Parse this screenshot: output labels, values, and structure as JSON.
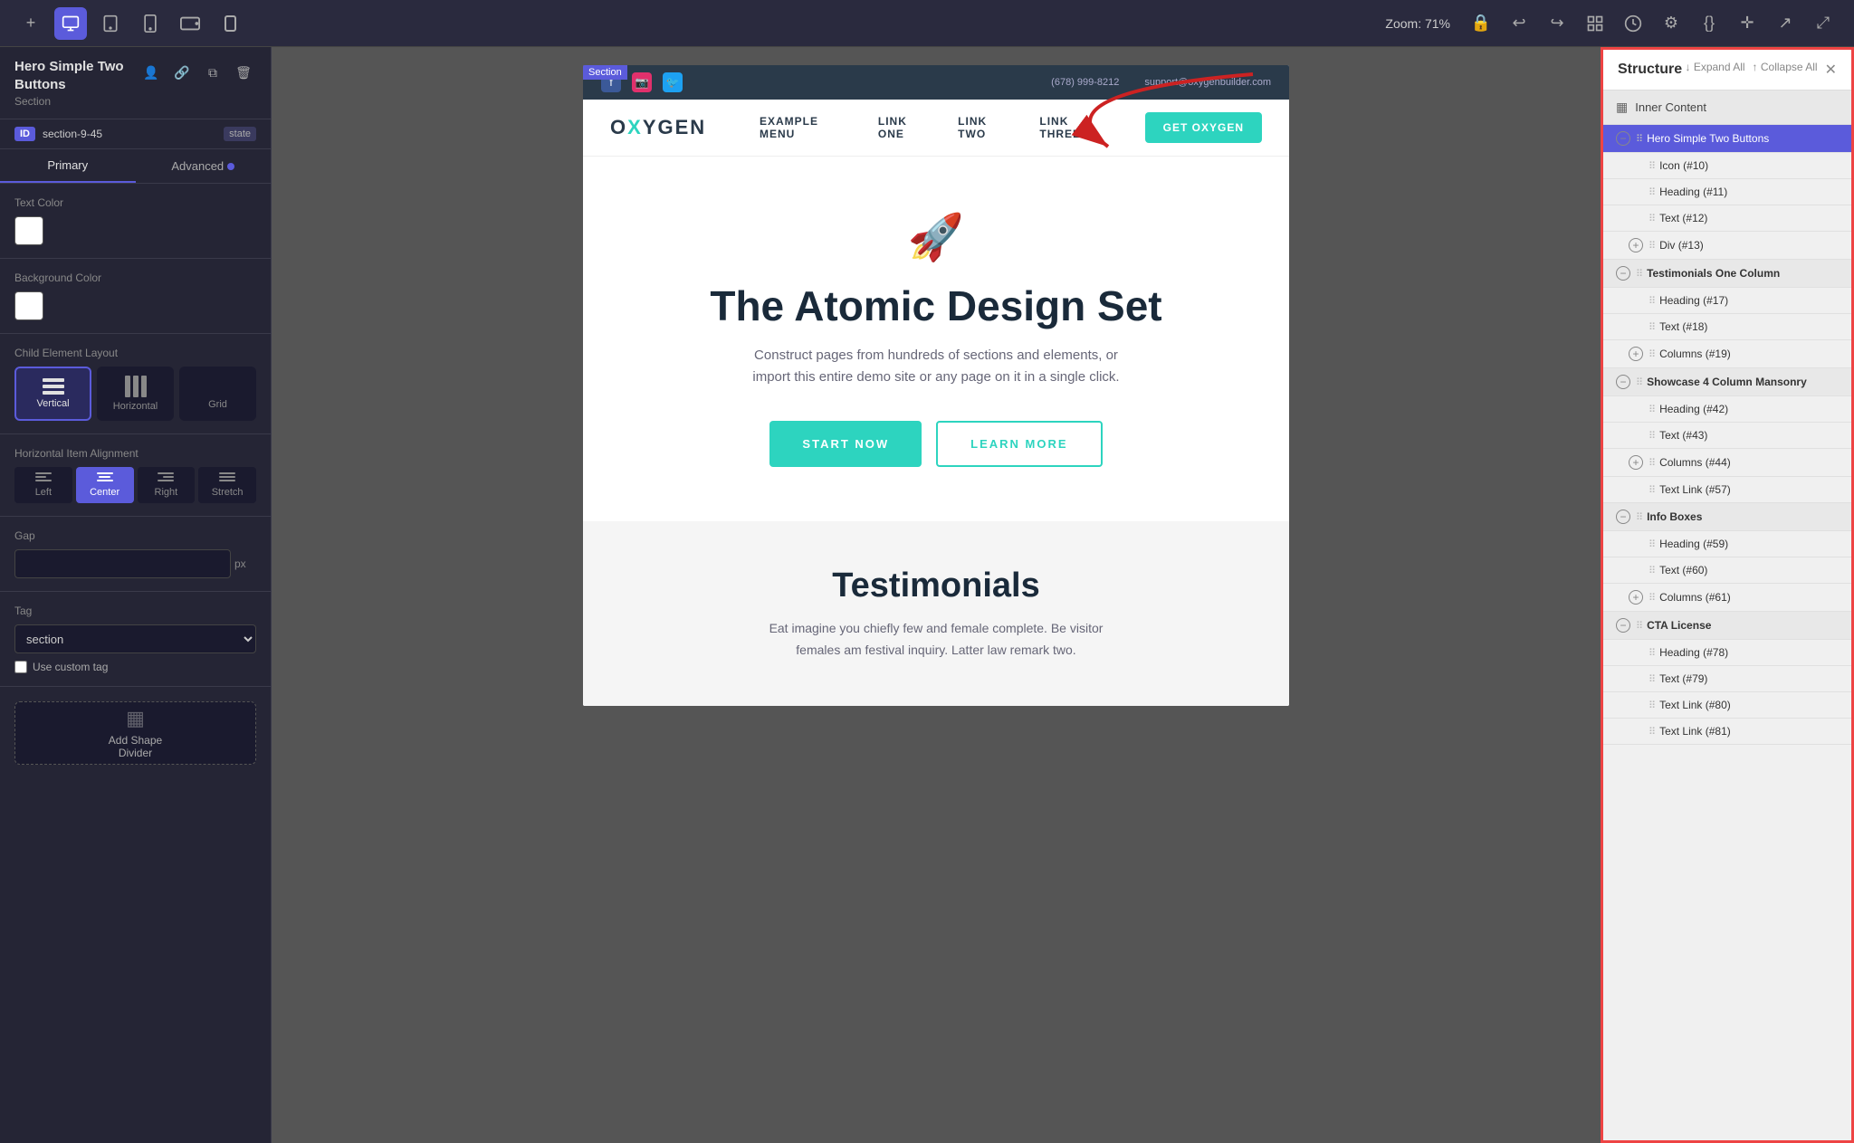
{
  "toolbar": {
    "device_desktop_label": "Desktop",
    "device_tablet_label": "Tablet",
    "device_mobile_label": "Mobile",
    "device_landscape_label": "Landscape",
    "device_mobile2_label": "Mobile 2",
    "zoom_label": "Zoom: 71%",
    "add_btn_label": "+",
    "undo_label": "↩",
    "redo_label": "↪",
    "manage_label": "☰",
    "history_label": "⏰",
    "settings_label": "⚙",
    "css_label": "{}",
    "grid_label": "+",
    "share_label": "↗",
    "expand_label": "⤢"
  },
  "left_panel": {
    "title": "Hero Simple Two Buttons",
    "subtitle": "Section",
    "id_value": "section-9-45",
    "state_label": "state",
    "tab_primary": "Primary",
    "tab_advanced": "Advanced",
    "text_color_label": "Text Color",
    "bg_color_label": "Background Color",
    "child_layout_label": "Child Element Layout",
    "layout_vertical": "Vertical",
    "layout_horizontal": "Horizontal",
    "layout_grid": "Grid",
    "alignment_label": "Horizontal Item Alignment",
    "align_left": "Left",
    "align_center": "Center",
    "align_right": "Right",
    "align_stretch": "Stretch",
    "gap_label": "Gap",
    "gap_unit": "px",
    "tag_label": "Tag",
    "tag_value": "section",
    "custom_tag_label": "Use custom tag",
    "add_shape_label": "Add Shape\nDivider"
  },
  "canvas": {
    "section_badge": "Section",
    "site_logo": "OXYGEN",
    "nav_links": [
      "EXAMPLE MENU",
      "LINK ONE",
      "LINK TWO",
      "LINK THREE"
    ],
    "nav_cta": "GET OXYGEN",
    "phone": "(678) 999-8212",
    "email": "support@oxygenbuilder.com",
    "hero_title": "The Atomic Design Set",
    "hero_subtitle": "Construct pages from hundreds of sections and elements, or import this entire demo site or any page on it in a single click.",
    "btn_start": "START NOW",
    "btn_learn": "LEARN MORE",
    "testimonials_title": "Testimonials",
    "testimonials_text": "Eat imagine you chiefly few and female complete. Be visitor females am festival inquiry. Latter law remark two."
  },
  "right_panel": {
    "title": "Structure",
    "expand_all": "↓ Expand All",
    "collapse_all": "↑ Collapse All",
    "inner_content": "Inner Content",
    "items": [
      {
        "level": 0,
        "toggle": "minus",
        "label": "Hero Simple Two Buttons",
        "active": true,
        "id": ""
      },
      {
        "level": 1,
        "toggle": "none",
        "label": "Icon (#10)",
        "active": false,
        "id": ""
      },
      {
        "level": 1,
        "toggle": "none",
        "label": "Heading (#11)",
        "active": false,
        "id": ""
      },
      {
        "level": 1,
        "toggle": "none",
        "label": "Text (#12)",
        "active": false,
        "id": ""
      },
      {
        "level": 1,
        "toggle": "plus",
        "label": "Div (#13)",
        "active": false,
        "id": ""
      },
      {
        "level": 0,
        "toggle": "minus",
        "label": "Testimonials One Column",
        "active": false,
        "id": "",
        "section": true
      },
      {
        "level": 1,
        "toggle": "none",
        "label": "Heading (#17)",
        "active": false,
        "id": ""
      },
      {
        "level": 1,
        "toggle": "none",
        "label": "Text (#18)",
        "active": false,
        "id": ""
      },
      {
        "level": 1,
        "toggle": "plus",
        "label": "Columns (#19)",
        "active": false,
        "id": ""
      },
      {
        "level": 0,
        "toggle": "minus",
        "label": "Showcase 4 Column Mansonry",
        "active": false,
        "id": "",
        "section": true
      },
      {
        "level": 1,
        "toggle": "none",
        "label": "Heading (#42)",
        "active": false,
        "id": ""
      },
      {
        "level": 1,
        "toggle": "none",
        "label": "Text (#43)",
        "active": false,
        "id": ""
      },
      {
        "level": 1,
        "toggle": "plus",
        "label": "Columns (#44)",
        "active": false,
        "id": ""
      },
      {
        "level": 1,
        "toggle": "none",
        "label": "Text Link (#57)",
        "active": false,
        "id": ""
      },
      {
        "level": 0,
        "toggle": "minus",
        "label": "Info Boxes",
        "active": false,
        "id": "",
        "section": true
      },
      {
        "level": 1,
        "toggle": "none",
        "label": "Heading (#59)",
        "active": false,
        "id": ""
      },
      {
        "level": 1,
        "toggle": "none",
        "label": "Text (#60)",
        "active": false,
        "id": ""
      },
      {
        "level": 1,
        "toggle": "plus",
        "label": "Columns (#61)",
        "active": false,
        "id": ""
      },
      {
        "level": 0,
        "toggle": "minus",
        "label": "CTA License",
        "active": false,
        "id": "",
        "section": true
      },
      {
        "level": 1,
        "toggle": "none",
        "label": "Heading (#78)",
        "active": false,
        "id": ""
      },
      {
        "level": 1,
        "toggle": "none",
        "label": "Text (#79)",
        "active": false,
        "id": ""
      },
      {
        "level": 1,
        "toggle": "none",
        "label": "Text Link (#80)",
        "active": false,
        "id": ""
      },
      {
        "level": 1,
        "toggle": "none",
        "label": "Text Link (#81)",
        "active": false,
        "id": ""
      }
    ]
  }
}
